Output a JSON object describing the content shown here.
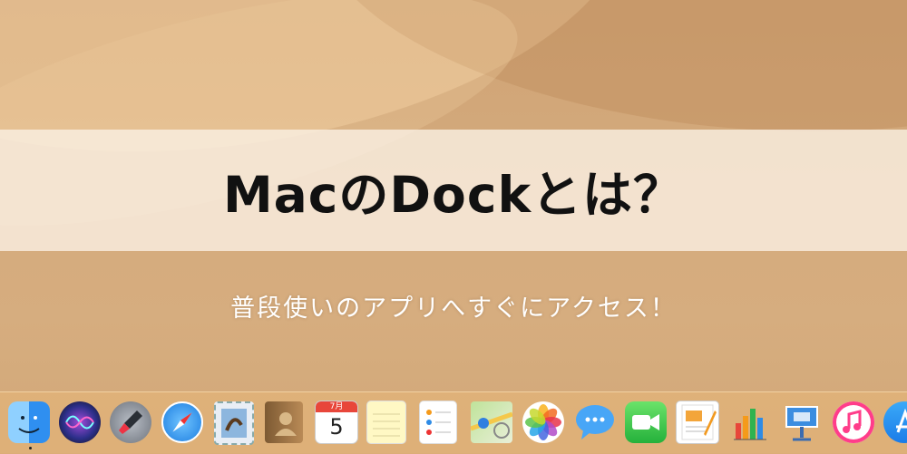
{
  "banner": {
    "title": "MacのDockとは？",
    "subtitle": "普段使いのアプリへすぐにアクセス！"
  },
  "calendar": {
    "month": "7月",
    "day": "5"
  },
  "dock_apps": [
    {
      "name": "Finder",
      "icon": "finder-icon",
      "color": "#3aa0f0"
    },
    {
      "name": "Siri",
      "icon": "siri-icon",
      "color": "#2a3d8f"
    },
    {
      "name": "Launchpad",
      "icon": "launchpad-icon",
      "color": "#8a9099"
    },
    {
      "name": "Safari",
      "icon": "safari-icon",
      "color": "#2d8fe8"
    },
    {
      "name": "Mail",
      "icon": "mail-icon",
      "color": "#6fa3d6"
    },
    {
      "name": "Contacts",
      "icon": "contacts-icon",
      "color": "#a77b4a"
    },
    {
      "name": "Calendar",
      "icon": "calendar-icon",
      "color": "#ffffff"
    },
    {
      "name": "Notes",
      "icon": "notes-icon",
      "color": "#fff7b0"
    },
    {
      "name": "Reminders",
      "icon": "reminders-icon",
      "color": "#ffffff"
    },
    {
      "name": "Maps",
      "icon": "maps-icon",
      "color": "#9fd07a"
    },
    {
      "name": "Photos",
      "icon": "photos-icon",
      "color": "#ffffff"
    },
    {
      "name": "Messages",
      "icon": "messages-icon",
      "color": "#3d9bf5"
    },
    {
      "name": "FaceTime",
      "icon": "facetime-icon",
      "color": "#34c34a"
    },
    {
      "name": "Pages",
      "icon": "pages-icon",
      "color": "#f3a53a"
    },
    {
      "name": "Numbers",
      "icon": "numbers-icon",
      "color": "#ffffff"
    },
    {
      "name": "Keynote",
      "icon": "keynote-icon",
      "color": "#3b8de0"
    },
    {
      "name": "iTunes",
      "icon": "itunes-icon",
      "color": "#ff3d8a"
    },
    {
      "name": "App Store",
      "icon": "app-store-icon",
      "color": "#1b8ff2"
    }
  ]
}
